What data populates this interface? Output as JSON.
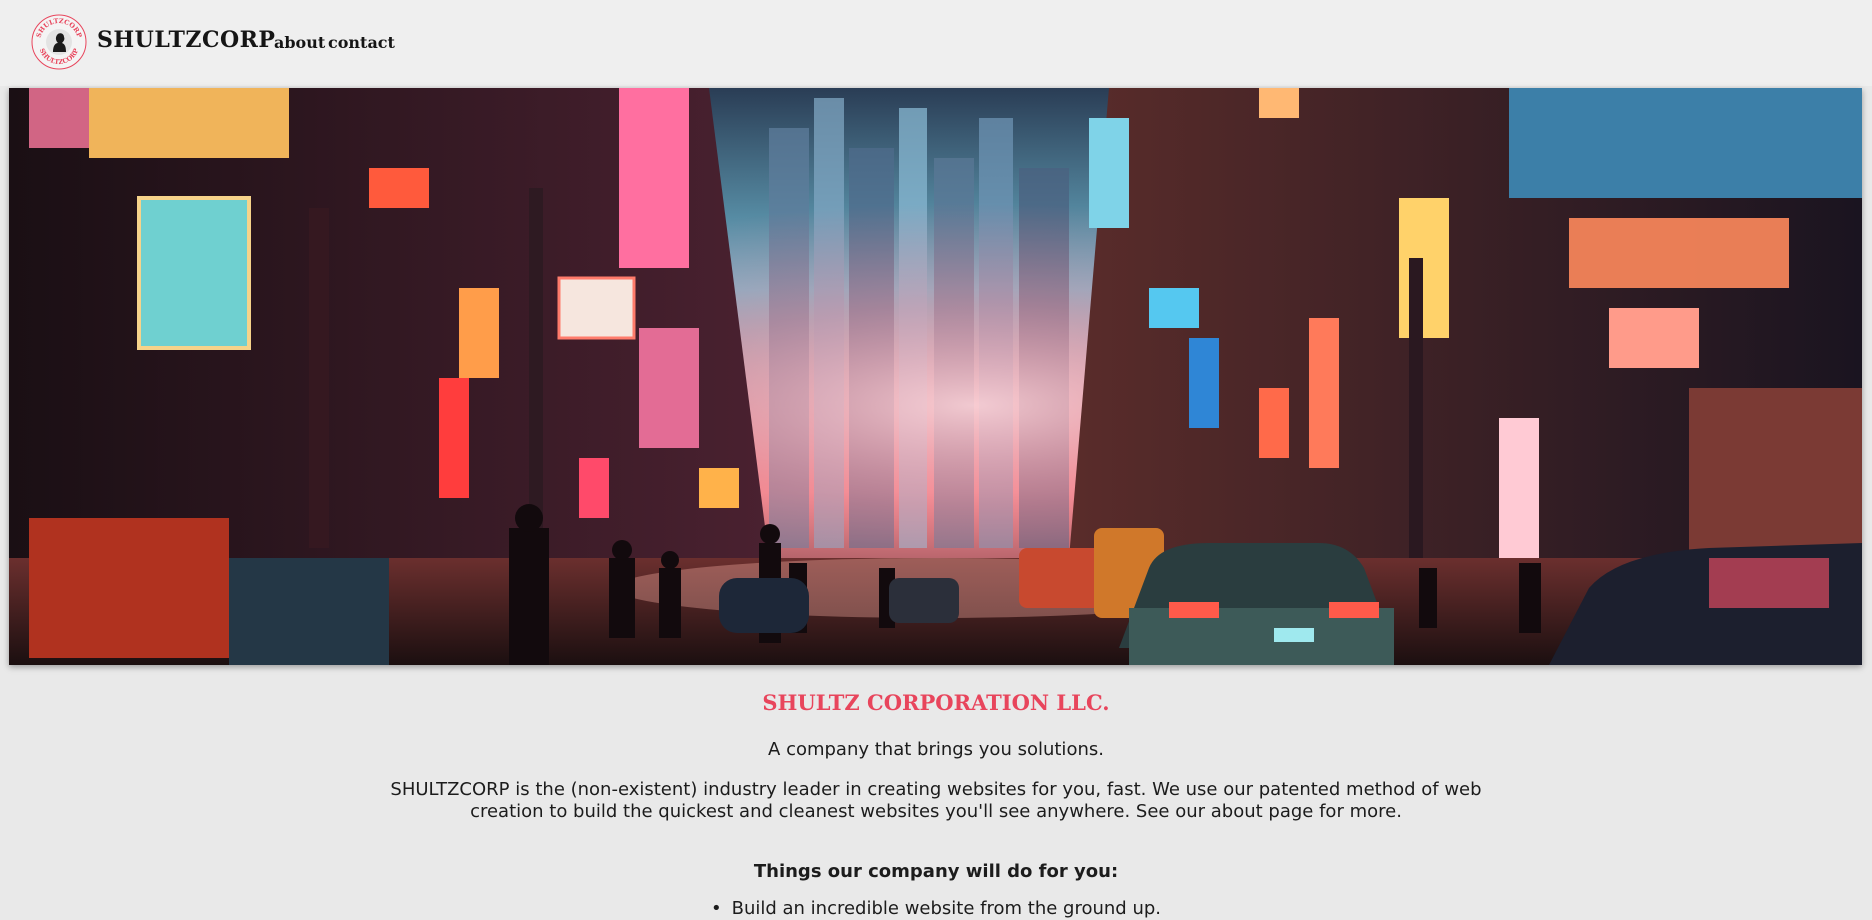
{
  "header": {
    "brand": "SHULTZCORP",
    "logo_ring_text": "SHULTZCORP",
    "nav": [
      "about",
      "contact"
    ]
  },
  "hero": {
    "description": "neon cyberpunk city street with signs, people and cars"
  },
  "main": {
    "title": "SHULTZ CORPORATION LLC.",
    "tagline": "A company that brings you solutions.",
    "description": "SHULTZCORP is the (non-existent) industry leader in creating websites for you, fast. We use our patented method of web creation to build the quickest and cleanest websites you'll see anywhere. See our about page for more.",
    "list_heading": "Things our company will do for you:",
    "list_items": [
      "Build an incredible website from the ground up."
    ]
  },
  "colors": {
    "accent": "#e8455c",
    "page_bg": "#e9e9e9",
    "header_bg": "#efefef"
  }
}
